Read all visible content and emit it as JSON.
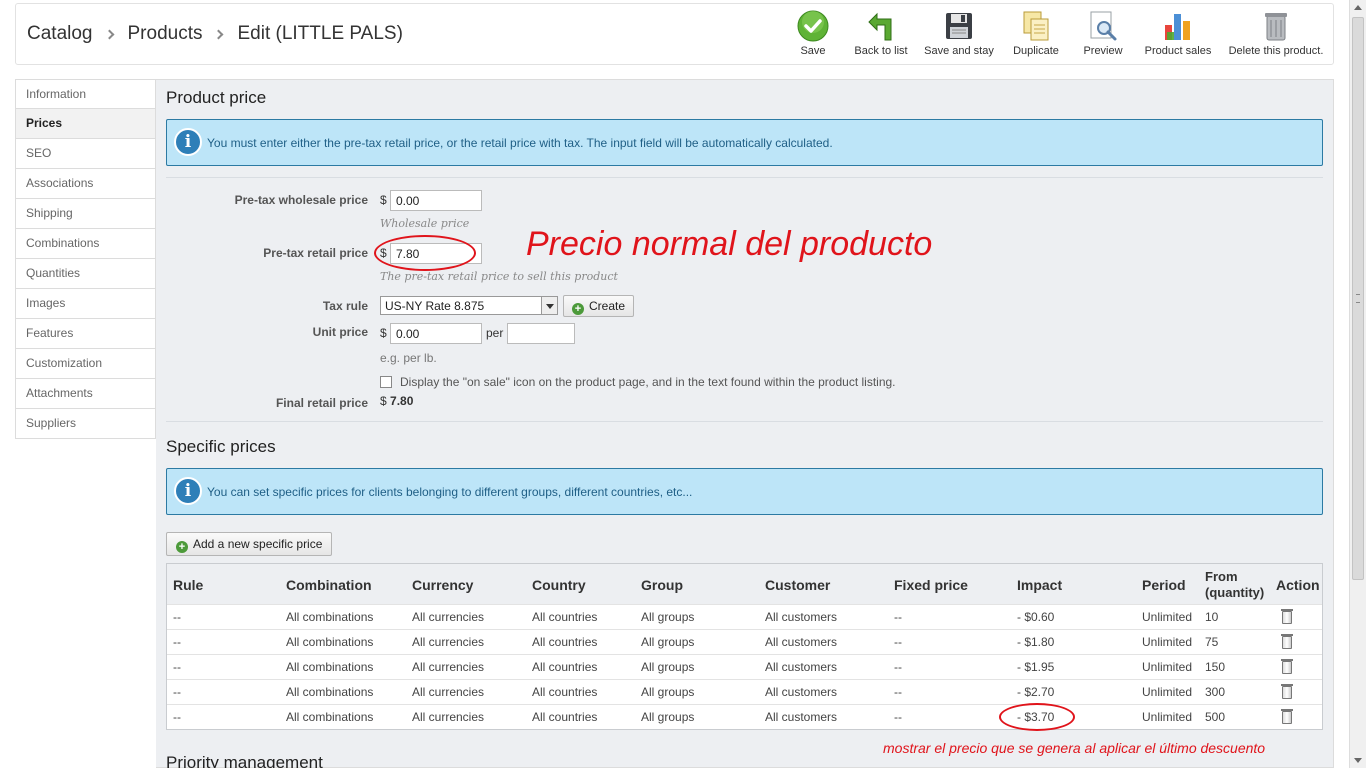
{
  "breadcrumb": [
    "Catalog",
    "Products",
    "Edit (LITTLE PALS)"
  ],
  "toolbar": [
    {
      "label": "Save",
      "icon": "save-check-icon"
    },
    {
      "label": "Back to list",
      "icon": "back-arrow-icon"
    },
    {
      "label": "Save and stay",
      "icon": "floppy-disk-icon"
    },
    {
      "label": "Duplicate",
      "icon": "duplicate-icon"
    },
    {
      "label": "Preview",
      "icon": "preview-magnifier-icon"
    },
    {
      "label": "Product sales",
      "icon": "bar-chart-icon"
    },
    {
      "label": "Delete this product.",
      "icon": "trash-bin-icon"
    }
  ],
  "sidebar": {
    "items": [
      {
        "label": "Information"
      },
      {
        "label": "Prices",
        "active": true
      },
      {
        "label": "SEO"
      },
      {
        "label": "Associations"
      },
      {
        "label": "Shipping"
      },
      {
        "label": "Combinations"
      },
      {
        "label": "Quantities"
      },
      {
        "label": "Images"
      },
      {
        "label": "Features"
      },
      {
        "label": "Customization"
      },
      {
        "label": "Attachments"
      },
      {
        "label": "Suppliers"
      }
    ]
  },
  "product_price": {
    "title": "Product price",
    "info": "You must enter either the pre-tax retail price, or the retail price with tax. The input field will be automatically calculated.",
    "wholesale_label": "Pre-tax wholesale price",
    "wholesale_currency": "$",
    "wholesale_value": "0.00",
    "wholesale_hint": "Wholesale price",
    "retail_label": "Pre-tax retail price",
    "retail_currency": "$",
    "retail_value": "7.80",
    "retail_hint": "The pre-tax retail price to sell this product",
    "tax_rule_label": "Tax rule",
    "tax_rule_value": "US-NY Rate 8.875",
    "create_button": "Create",
    "unit_price_label": "Unit price",
    "unit_price_currency": "$",
    "unit_price_value": "0.00",
    "unit_per": "per",
    "unit_per_value": "",
    "unit_hint": "e.g. per lb.",
    "on_sale_label": "Display the \"on sale\" icon on the product page, and in the text found within the product listing.",
    "final_label": "Final retail price",
    "final_currency": "$",
    "final_value": "7.80"
  },
  "annotations": {
    "price_note": "Precio normal del producto",
    "discount_note": "mostrar el precio que se genera al aplicar el último descuento",
    "color": "#e0141b"
  },
  "specific_prices": {
    "title": "Specific prices",
    "info": "You can set specific prices for clients belonging to different groups, different countries, etc...",
    "add_button": "Add a new specific price",
    "columns": [
      "Rule",
      "Combination",
      "Currency",
      "Country",
      "Group",
      "Customer",
      "Fixed price",
      "Impact",
      "Period",
      "From (quantity)",
      "Action"
    ],
    "rows": [
      [
        "--",
        "All combinations",
        "All currencies",
        "All countries",
        "All groups",
        "All customers",
        "--",
        "- $0.60",
        "Unlimited",
        "10"
      ],
      [
        "--",
        "All combinations",
        "All currencies",
        "All countries",
        "All groups",
        "All customers",
        "--",
        "- $1.80",
        "Unlimited",
        "75"
      ],
      [
        "--",
        "All combinations",
        "All currencies",
        "All countries",
        "All groups",
        "All customers",
        "--",
        "- $1.95",
        "Unlimited",
        "150"
      ],
      [
        "--",
        "All combinations",
        "All currencies",
        "All countries",
        "All groups",
        "All customers",
        "--",
        "- $2.70",
        "Unlimited",
        "300"
      ],
      [
        "--",
        "All combinations",
        "All currencies",
        "All countries",
        "All groups",
        "All customers",
        "--",
        "- $3.70",
        "Unlimited",
        "500"
      ]
    ]
  },
  "priority": {
    "title": "Priority management"
  },
  "colors": {
    "info_bg": "#bde5f8",
    "info_text": "#1f5f86",
    "panel_bg": "#edeff2"
  }
}
